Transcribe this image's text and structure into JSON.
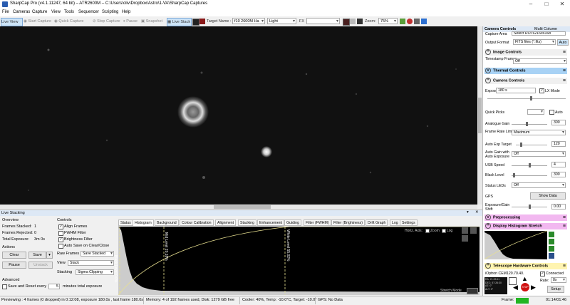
{
  "window": {
    "title": "SharpCap Pro (v4.1.11247, 64 bit) – ATR2600M – C:\\Users\\oliv\\Dropbox\\Astro\\1-VA\\SharpCap Captures",
    "minimize": "–",
    "maximize": "□",
    "close": "✕"
  },
  "menu": [
    "File",
    "Cameras",
    "Capture",
    "View",
    "Tools",
    "Sequencer",
    "Scripting",
    "Help"
  ],
  "toolbar": {
    "live_view": "Live View",
    "start_capture": "Start Capture",
    "quick_capture": "Quick Capture",
    "stop_capture": "Stop Capture",
    "pause": "Pause",
    "snapshot": "Snapshot",
    "live_stack": "Live Stack",
    "target_label": "Target Name :",
    "target_value": "f10 2600M Ha",
    "frame_type": "Light",
    "fx_label": "FX",
    "zoom_label": "Zoom:",
    "zoom_value": "75%"
  },
  "right_panel": {
    "header": "Camera Controls",
    "multi_column": "Multi Column",
    "capture_area_label": "Capture Area",
    "capture_area_value": "Select ROI 6216x4168",
    "output_format_label": "Output Format",
    "output_format_value": "FITS files (*.fits)",
    "output_auto": "Auto",
    "image_controls": "Image Controls",
    "timestamp_label": "Timestamp Frames",
    "timestamp_value": "Off",
    "thermal_controls": "Thermal Controls",
    "camera_controls": "Camera Controls",
    "exposure_label": "Exposure",
    "exposure_value": "180 s",
    "lx_mode": "LX Mode",
    "quick_picks_label": "Quick Picks",
    "quick_picks_auto": "Auto",
    "analogue_gain_label": "Analogue Gain",
    "analogue_gain_value": "300",
    "frame_rate_label": "Frame Rate Limit",
    "frame_rate_value": "Maximum",
    "auto_exp_target_label": "Auto Exp Target",
    "auto_exp_target_value": "120",
    "auto_gain_label": "Auto Gain with Auto Exposure",
    "auto_gain_value": "Off",
    "usb_speed_label": "USB Speed",
    "usb_speed_value": "4",
    "black_level_label": "Black Level",
    "black_level_value": "300",
    "status_leds_label": "Status LEDs",
    "status_leds_value": "Off",
    "gps_label": "GPS",
    "show_data": "Show Data",
    "exp_gain_shift_label": "Exposure/Gain Shift",
    "exp_gain_shift_value": "0.00",
    "preprocessing": "Preprocessing",
    "display_histogram": "Display Histogram Stretch",
    "telescope_hw": "Telescope Hardware Controls",
    "mount_name": "iOptron CEM120.70.40.26, Ol...",
    "connected": "Connected",
    "rate_label": "Rate:",
    "rate_value": "8x",
    "setup": "Setup",
    "stop": "STOP",
    "ra_readout": "RA: 21:35:11\nDEC: 57:26:30\nAZ: 0°\nALT: 0°"
  },
  "live_stacking": {
    "header": "Live Stacking",
    "overview": "Overview",
    "frames_stacked_label": "Frames Stacked:",
    "frames_stacked_value": "1",
    "frames_rejected_label": "Frames Rejected:",
    "frames_rejected_value": "0",
    "total_exposure_label": "Total Exposure:",
    "total_exposure_value": "3m 0s",
    "actions": "Actions",
    "clear": "Clear",
    "save": "Save",
    "pause": "Pause",
    "unstack": "Unstack",
    "advanced": "Advanced",
    "save_reset_label": "Save and Reset every",
    "save_reset_value": "5",
    "save_reset_unit": "minutes total exposure",
    "controls": "Controls",
    "align_frames": "Align Frames",
    "fwhm_filter": "FWHM Filter",
    "brightness_filter": "Brightness Filter",
    "auto_save": "Auto Save on Clear/Close",
    "raw_frames_label": "Raw Frames",
    "raw_frames_value": "Save Stacked",
    "view_label": "View",
    "view_value": "Stack",
    "stacking_label": "Stacking",
    "stacking_value": "Sigma Clipping",
    "tabs": [
      "Status",
      "Histogram",
      "Background",
      "Colour Calibration",
      "Alignment",
      "Stacking",
      "Enhancement",
      "Guiding",
      "Filter (FWHM)",
      "Filter (Brightness)",
      "Drift Graph",
      "Log",
      "Settings"
    ],
    "histo_horiz_axis": "Horiz. Axis:",
    "histo_zoom": "Zoom",
    "histo_log": "Log",
    "histo_black_level": "Black Level 0.0%",
    "histo_mid_level": "Mid Level 20.18%",
    "histo_white_level": "White Level 55.02%",
    "histo_stretch_mode": "Stretch Mode"
  },
  "status_bar": {
    "preview": "Previewing : 4 frames (0 dropped) in 0:12:08, exposure 180.0s , last frame 180.0s",
    "memory": "Memory: 4 of 192 frames used, Disk: 1279 GB free",
    "cooler": "Cooler: 40%, Temp: -10.0°C, Target: -10.0°",
    "gps": "GPS: No Data",
    "frame_label": "Frame:",
    "time": "01:14/01:46"
  }
}
